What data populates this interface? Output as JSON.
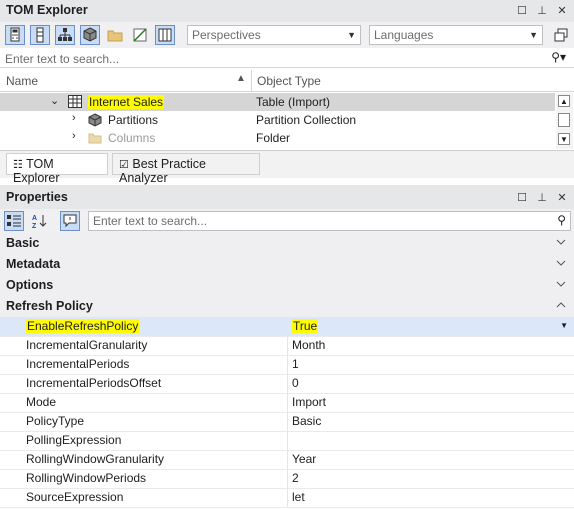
{
  "tom": {
    "title": "TOM Explorer",
    "perspectives": "Perspectives",
    "languages": "Languages",
    "search_placeholder": "Enter text to search...",
    "col_name": "Name",
    "col_type": "Object Type",
    "rows": [
      {
        "name": "Internet Sales",
        "type": "Table (Import)"
      },
      {
        "name": "Partitions",
        "type": "Partition Collection"
      },
      {
        "name": "Columns",
        "type": "Folder"
      }
    ],
    "tabs": [
      "TOM Explorer",
      "Best Practice Analyzer"
    ]
  },
  "props": {
    "title": "Properties",
    "search_placeholder": "Enter text to search...",
    "groups": [
      "Basic",
      "Metadata",
      "Options",
      "Refresh Policy"
    ],
    "rows": [
      {
        "k": "EnableRefreshPolicy",
        "v": "True"
      },
      {
        "k": "IncrementalGranularity",
        "v": "Month"
      },
      {
        "k": "IncrementalPeriods",
        "v": "1"
      },
      {
        "k": "IncrementalPeriodsOffset",
        "v": "0"
      },
      {
        "k": "Mode",
        "v": "Import"
      },
      {
        "k": "PolicyType",
        "v": "Basic"
      },
      {
        "k": "PollingExpression",
        "v": ""
      },
      {
        "k": "RollingWindowGranularity",
        "v": "Year"
      },
      {
        "k": "RollingWindowPeriods",
        "v": "2"
      },
      {
        "k": "SourceExpression",
        "v": "let"
      }
    ]
  },
  "colors": {
    "highlight": "#fffb00",
    "accent": "#c9dcf5"
  }
}
